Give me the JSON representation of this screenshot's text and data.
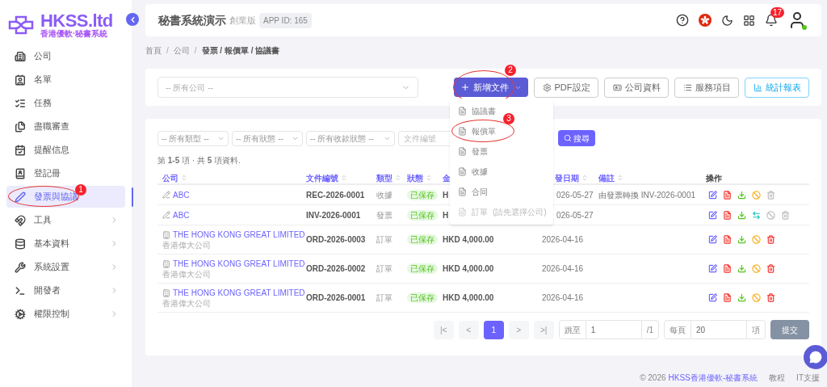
{
  "logo": {
    "title": "HKSS.ltd",
    "subtitle": "香港優軟·秘書系統"
  },
  "sidebar": {
    "items": [
      {
        "label": "公司",
        "selected": false,
        "expandable": false,
        "circled": false
      },
      {
        "label": "名單",
        "selected": false,
        "expandable": false,
        "circled": false
      },
      {
        "label": "任務",
        "selected": false,
        "expandable": false,
        "circled": false
      },
      {
        "label": "盡職審查",
        "selected": false,
        "expandable": false,
        "circled": false
      },
      {
        "label": "提醒信息",
        "selected": false,
        "expandable": false,
        "circled": false
      },
      {
        "label": "登記冊",
        "selected": false,
        "expandable": false,
        "circled": false
      },
      {
        "label": "發票與協議",
        "selected": true,
        "expandable": false,
        "circled": true,
        "marker": "1"
      },
      {
        "label": "工具",
        "selected": false,
        "expandable": true,
        "circled": false
      },
      {
        "label": "基本資料",
        "selected": false,
        "expandable": true,
        "circled": false
      },
      {
        "label": "系統設置",
        "selected": false,
        "expandable": true,
        "circled": false
      },
      {
        "label": "開發者",
        "selected": false,
        "expandable": true,
        "circled": false
      },
      {
        "label": "權限控制",
        "selected": false,
        "expandable": true,
        "circled": false
      }
    ]
  },
  "header": {
    "title": "秘書系統演示",
    "edition": "創業版",
    "app_id": "APP ID: 165",
    "notifications": "17"
  },
  "breadcrumb": [
    {
      "label": "首頁",
      "kind": "link"
    },
    {
      "label": "/",
      "kind": "separator"
    },
    {
      "label": "公司",
      "kind": "link"
    },
    {
      "label": "/",
      "kind": "separator"
    },
    {
      "label": "發票 / 報價單 / 協議書",
      "kind": "current"
    }
  ],
  "toolbar": {
    "company_select": {
      "placeholder": "-- 所有公司 --"
    },
    "new_button": {
      "label": "新增文件",
      "circled": true,
      "marker": "2"
    },
    "buttons": [
      {
        "label": "PDF設定",
        "kind": "plain"
      },
      {
        "label": "公司資料",
        "kind": "plain"
      },
      {
        "label": "服務項目",
        "kind": "plain"
      },
      {
        "label": "統計報表",
        "kind": "accent"
      }
    ]
  },
  "new_menu": {
    "items": [
      {
        "label": "協議書",
        "disabled": false,
        "circled": false
      },
      {
        "label": "報價單",
        "disabled": false,
        "circled": true,
        "marker": "3"
      },
      {
        "label": "發票",
        "disabled": false,
        "circled": false
      },
      {
        "label": "收據",
        "disabled": false,
        "circled": false
      },
      {
        "label": "合同",
        "disabled": false,
        "circled": false
      },
      {
        "label": "訂單",
        "hint": "(請先選擇公司)",
        "disabled": true,
        "circled": false
      }
    ]
  },
  "filters": {
    "selects": [
      {
        "placeholder": "-- 所有類型 --"
      },
      {
        "placeholder": "-- 所有狀態 --"
      },
      {
        "placeholder": "-- 所有收款狀態 --"
      }
    ],
    "doc_field": {
      "placeholder": "文件編號"
    },
    "search_button": "搜尋"
  },
  "summary": "第 **1-5** 項 · 共 **5** 項資料.",
  "table": {
    "columns": [
      {
        "label": "公司",
        "sortable": true
      },
      {
        "label": "文件編號",
        "sortable": true
      },
      {
        "label": "類型",
        "sortable": true
      },
      {
        "label": "狀態",
        "sortable": true
      },
      {
        "label": "金",
        "sortable": false
      },
      {
        "label": "發日期",
        "sortable": true
      },
      {
        "label": "備註",
        "sortable": true
      },
      {
        "label": "操作",
        "sortable": false
      }
    ],
    "rows": [
      {
        "kind": "pencil",
        "company": "ABC",
        "doc_no": "REC-2026-0001",
        "type": "收據",
        "status": "已保存",
        "amount": "H",
        "date": "026-05-27",
        "remark": "由發票轉換 INV-2026-0001",
        "actions": [
          {
            "kind": "edit",
            "disabled": false
          },
          {
            "kind": "pdf",
            "disabled": false
          },
          {
            "kind": "download",
            "disabled": false
          },
          {
            "kind": "void",
            "disabled": false
          },
          {
            "kind": "delete",
            "disabled": true
          }
        ]
      },
      {
        "kind": "pencil",
        "company": "ABC",
        "doc_no": "INV-2026-0001",
        "type": "發票",
        "status": "已保存",
        "amount": "H",
        "date": "026-05-27",
        "actions": [
          {
            "kind": "edit",
            "disabled": false
          },
          {
            "kind": "pdf",
            "disabled": false
          },
          {
            "kind": "download",
            "disabled": false
          },
          {
            "kind": "convert",
            "disabled": false
          },
          {
            "kind": "void",
            "disabled": true
          },
          {
            "kind": "delete",
            "disabled": true
          }
        ]
      },
      {
        "kind": "building",
        "company": "THE HONG KONG GREAT LIMITED",
        "company_sub": "香港偉大公司",
        "doc_no": "ORD-2026-0003",
        "type": "訂單",
        "status": "已保存",
        "amount": "HKD 4,000.00",
        "date": "2026-04-16",
        "actions": [
          {
            "kind": "edit",
            "disabled": false
          },
          {
            "kind": "pdf",
            "disabled": false
          },
          {
            "kind": "download",
            "disabled": false
          },
          {
            "kind": "void",
            "disabled": false
          },
          {
            "kind": "delete",
            "disabled": false
          }
        ]
      },
      {
        "kind": "building",
        "company": "THE HONG KONG GREAT LIMITED",
        "company_sub": "香港偉大公司",
        "doc_no": "ORD-2026-0002",
        "type": "訂單",
        "status": "已保存",
        "amount": "HKD 4,000.00",
        "date": "2026-04-16",
        "actions": [
          {
            "kind": "edit",
            "disabled": false
          },
          {
            "kind": "pdf",
            "disabled": false
          },
          {
            "kind": "download",
            "disabled": false
          },
          {
            "kind": "void",
            "disabled": false
          },
          {
            "kind": "delete",
            "disabled": false
          }
        ]
      },
      {
        "kind": "building",
        "company": "THE HONG KONG GREAT LIMITED",
        "company_sub": "香港偉大公司",
        "doc_no": "ORD-2026-0001",
        "type": "訂單",
        "status": "已保存",
        "amount": "HKD 4,000.00",
        "date": "2026-04-16",
        "actions": [
          {
            "kind": "edit",
            "disabled": false
          },
          {
            "kind": "pdf",
            "disabled": false
          },
          {
            "kind": "download",
            "disabled": false
          },
          {
            "kind": "void",
            "disabled": false
          },
          {
            "kind": "delete",
            "disabled": false
          }
        ]
      }
    ]
  },
  "pagination": {
    "pages": [
      {
        "label": "|<",
        "selected": false
      },
      {
        "label": "<",
        "selected": false
      },
      {
        "label": "1",
        "selected": true
      },
      {
        "label": ">",
        "selected": false
      },
      {
        "label": ">|",
        "selected": false
      }
    ],
    "jump": {
      "label": "跳至",
      "value": "1",
      "suffix": "/1"
    },
    "per_page": {
      "label": "每頁",
      "value": "20",
      "suffix": "項"
    },
    "submit": "提交"
  },
  "footer": {
    "copyright": "© 2026",
    "link": "HKSS香港優軟-秘書系統",
    "links": [
      "教程",
      "IT支援"
    ]
  }
}
